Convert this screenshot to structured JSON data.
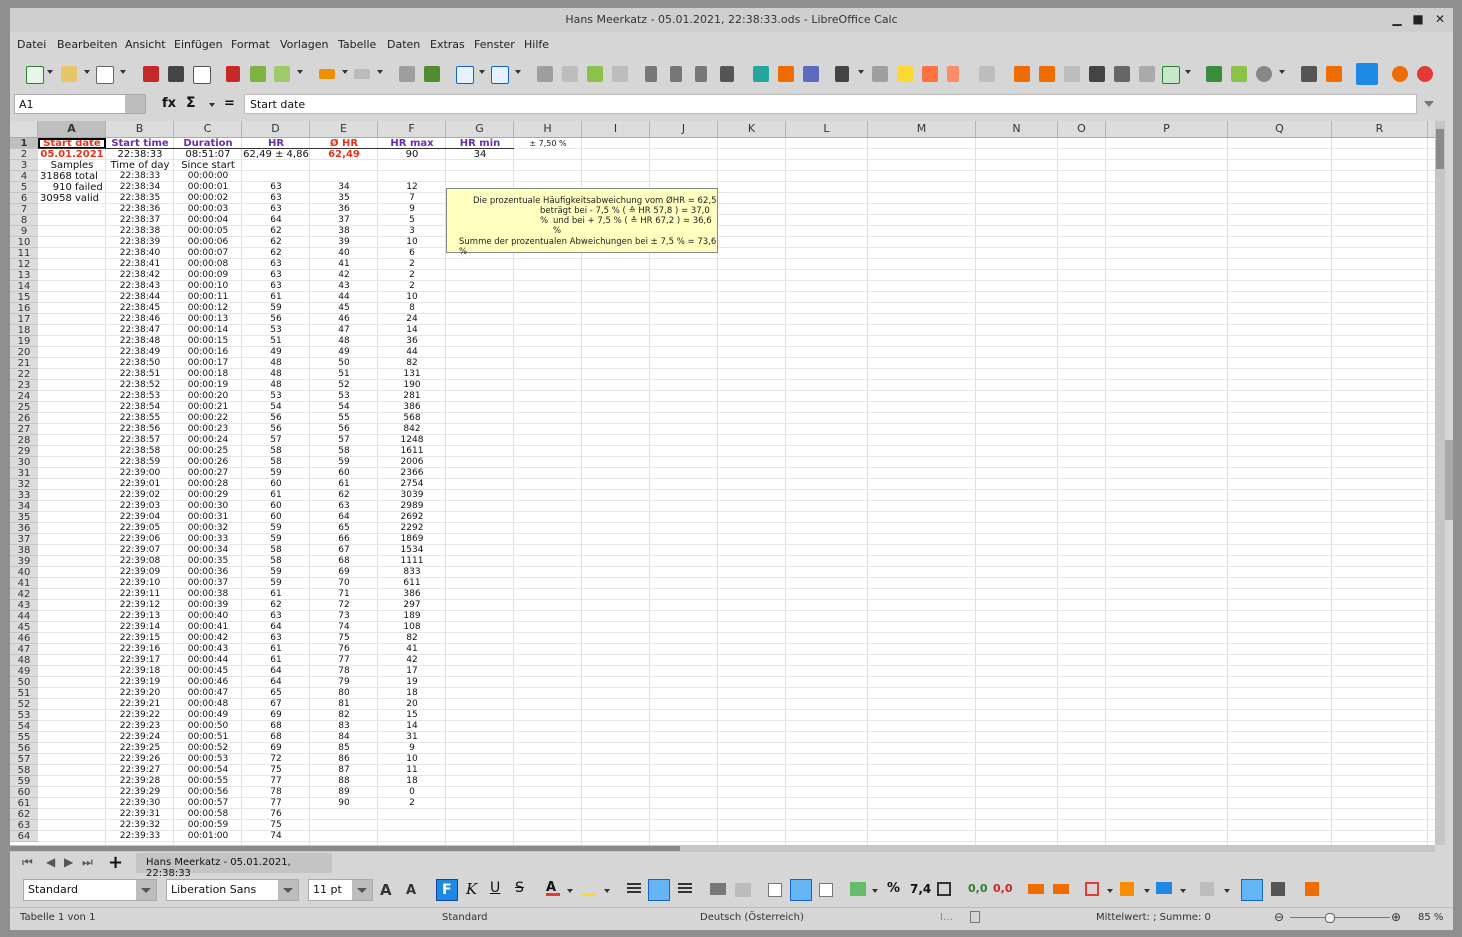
{
  "window": {
    "title": "Hans Meerkatz - 05.01.2021, 22:38:33.ods - LibreOffice Calc",
    "btn_min": "▁",
    "btn_max": "■",
    "btn_close": "✕"
  },
  "menu": [
    "Datei",
    "Bearbeiten",
    "Ansicht",
    "Einfügen",
    "Format",
    "Vorlagen",
    "Tabelle",
    "Daten",
    "Extras",
    "Fenster",
    "Hilfe"
  ],
  "namebox": "A1",
  "formula": {
    "fx": "fx",
    "sigma": "Σ",
    "eq": "=",
    "content": "Start date"
  },
  "columns": [
    "A",
    "B",
    "C",
    "D",
    "E",
    "F",
    "G",
    "H",
    "I",
    "J",
    "K",
    "L",
    "M",
    "N",
    "O",
    "P",
    "Q",
    "R"
  ],
  "headers": {
    "A": "Start date",
    "B": "Start time",
    "C": "Duration",
    "D": "HR",
    "E": "Ø HR",
    "F": "HR max",
    "G": "HR min",
    "H": "± 7,50  %"
  },
  "row2": {
    "A": "05.01.2021",
    "B": "22:38:33",
    "C": "08:51:07",
    "D": "62,49 ± 4,86",
    "E": "62,49",
    "F": "90",
    "G": "34"
  },
  "row3": {
    "A": "Samples",
    "B": "Time of day",
    "C": "Since start"
  },
  "samples": [
    {
      "n": "31868",
      "t": "total"
    },
    {
      "n": "910",
      "t": "failed"
    },
    {
      "n": "30958",
      "t": "valid"
    }
  ],
  "row4": {
    "B": "22:38:33",
    "C": "00:00:00"
  },
  "hr": [
    "63",
    "63",
    "63",
    "64",
    "62",
    "62",
    "62",
    "63",
    "63",
    "63",
    "61",
    "59",
    "56",
    "53",
    "51",
    "49",
    "48",
    "48",
    "48",
    "53",
    "54",
    "56",
    "56",
    "57",
    "58",
    "58",
    "59",
    "60",
    "61",
    "60",
    "60",
    "59",
    "59",
    "58",
    "58",
    "59",
    "59",
    "61",
    "62",
    "63",
    "64",
    "63",
    "61",
    "61",
    "64",
    "64",
    "65",
    "67",
    "69",
    "68",
    "68",
    "69",
    "72",
    "75",
    "77",
    "78",
    "77",
    "76",
    "75",
    "74"
  ],
  "hist_e": [
    "34",
    "35",
    "36",
    "37",
    "38",
    "39",
    "40",
    "41",
    "42",
    "43",
    "44",
    "45",
    "46",
    "47",
    "48",
    "49",
    "50",
    "51",
    "52",
    "53",
    "54",
    "55",
    "56",
    "57",
    "58",
    "59",
    "60",
    "61",
    "62",
    "63",
    "64",
    "65",
    "66",
    "67",
    "68",
    "69",
    "70",
    "71",
    "72",
    "73",
    "74",
    "75",
    "76",
    "77",
    "78",
    "79",
    "80",
    "81",
    "82",
    "83",
    "84",
    "85",
    "86",
    "87",
    "88",
    "89",
    "90"
  ],
  "hist_f": [
    "12",
    "7",
    "9",
    "5",
    "3",
    "10",
    "6",
    "2",
    "2",
    "2",
    "10",
    "8",
    "24",
    "14",
    "36",
    "44",
    "82",
    "131",
    "190",
    "281",
    "386",
    "568",
    "842",
    "1248",
    "1611",
    "2006",
    "2366",
    "2754",
    "3039",
    "2989",
    "2692",
    "2292",
    "1869",
    "1534",
    "1111",
    "833",
    "611",
    "386",
    "297",
    "189",
    "108",
    "82",
    "41",
    "42",
    "17",
    "19",
    "18",
    "20",
    "15",
    "14",
    "31",
    "9",
    "10",
    "11",
    "18",
    "0",
    "2"
  ],
  "note": {
    "l1": "Die prozentuale Häufigkeitsabweichung vom ØHR = 62,5",
    "l2": "beträgt bei  - 7,5 % ( ≙ HR 57,8 ) = 37,0 %",
    "l3": "und bei  + 7,5 % ( ≙ HR 67,2 ) = 36,6 %",
    "l4": "Summe der prozentualen Abweichungen bei ± 7,5 % = 73,6 %"
  },
  "tab": {
    "label": "Hans Meerkatz - 05.01.2021, 22:38:33",
    "add": "+"
  },
  "format": {
    "style": "Standard",
    "font": "Liberation Sans",
    "size": "11 pt",
    "bold": "F",
    "italic": "K",
    "underline": "U",
    "strike": "S",
    "percent": "%",
    "decimal": "7,4",
    "dec_add": "0,0",
    "dec_del": "0,0"
  },
  "status": {
    "sheet": "Tabelle 1 von 1",
    "style": "Standard",
    "lang": "Deutsch (Österreich)",
    "sum": "Mittelwert: ; Summe: 0",
    "zoom": "85 %",
    "ins": "I…"
  },
  "colors": {
    "red": "#e8321e",
    "purple": "#6a2fa8",
    "note": "#ffffc0"
  }
}
